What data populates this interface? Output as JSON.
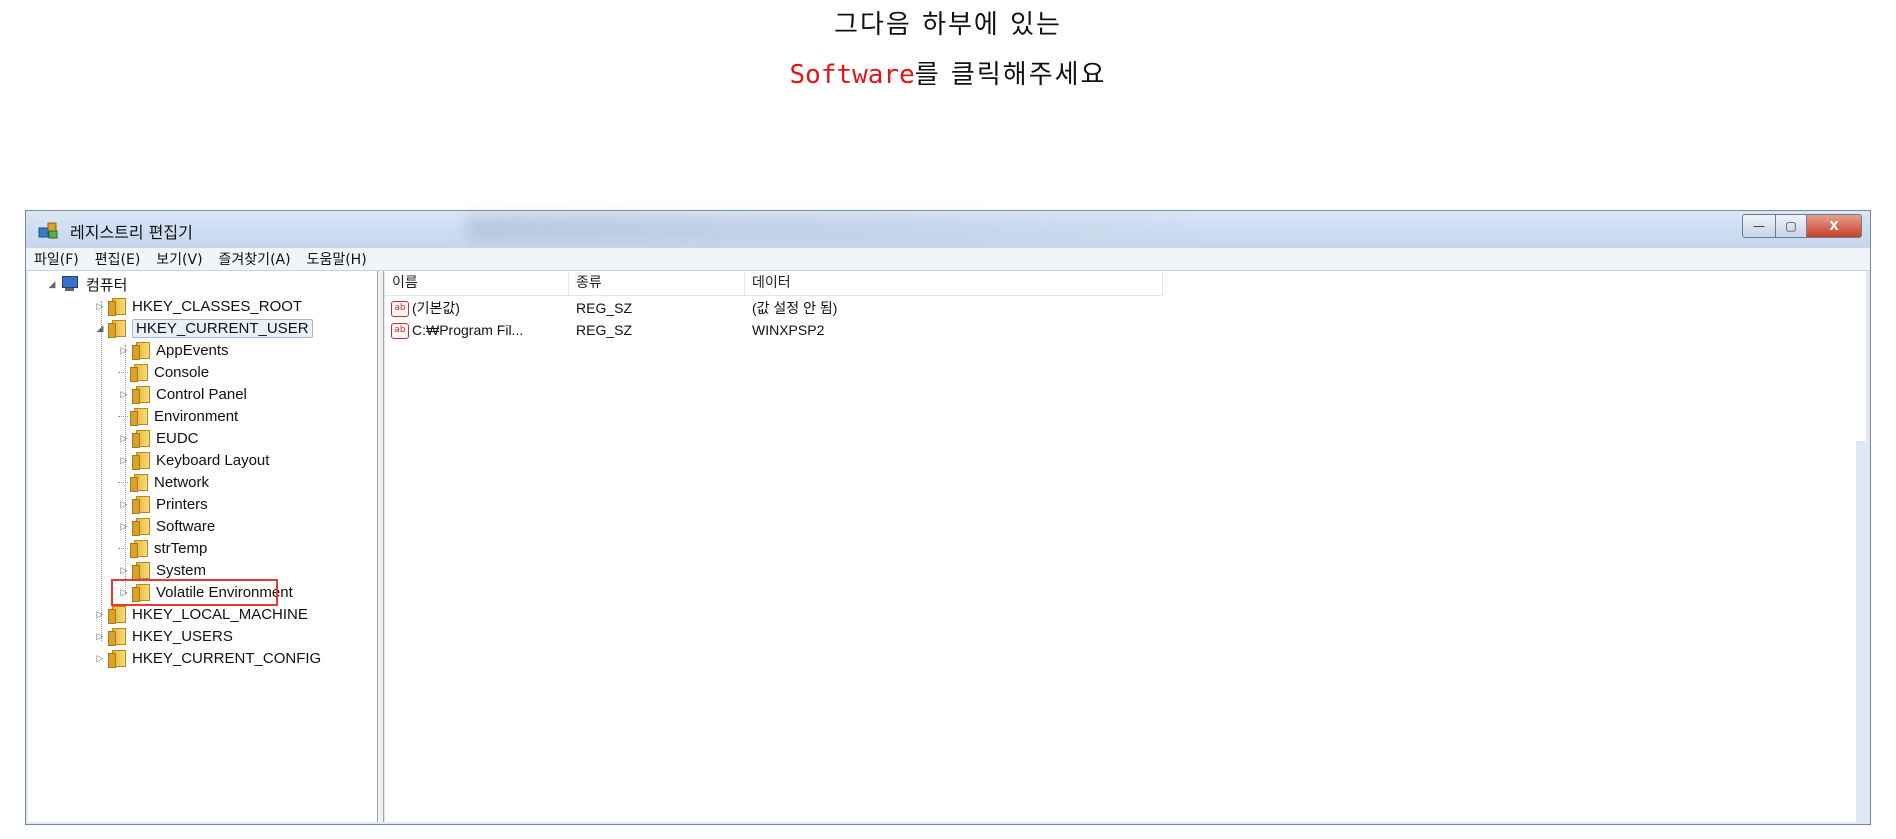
{
  "caption": {
    "line1": "그다음 하부에 있는",
    "line2_highlight": "Software",
    "line2_rest": "를 클릭해주세요"
  },
  "window": {
    "title": "레지스트리 편집기",
    "menu": [
      "파일(F)",
      "편집(E)",
      "보기(V)",
      "즐겨찾기(A)",
      "도움말(H)"
    ],
    "caption_buttons": {
      "min": "—",
      "max": "▢",
      "close": "X"
    }
  },
  "tree": {
    "root": "컴퓨터",
    "hkcr": "HKEY_CLASSES_ROOT",
    "hkcu": "HKEY_CURRENT_USER",
    "hkcu_children": [
      "AppEvents",
      "Console",
      "Control Panel",
      "Environment",
      "EUDC",
      "Keyboard Layout",
      "Network",
      "Printers",
      "Software",
      "strTemp",
      "System",
      "Volatile Environment"
    ],
    "hklm": "HKEY_LOCAL_MACHINE",
    "hku": "HKEY_USERS",
    "hkcc": "HKEY_CURRENT_CONFIG",
    "expander_open": "◢",
    "expander_closed": "▷"
  },
  "list": {
    "columns": [
      "이름",
      "종류",
      "데이터"
    ],
    "rows": [
      {
        "name": "(기본값)",
        "type": "REG_SZ",
        "data": "(값 설정 안 됨)"
      },
      {
        "name": "C:₩Program Fil...",
        "type": "REG_SZ",
        "data": "WINXPSP2"
      }
    ],
    "value_icon": "ab"
  },
  "colors": {
    "highlight": "#e01515",
    "box": "#e53935"
  }
}
